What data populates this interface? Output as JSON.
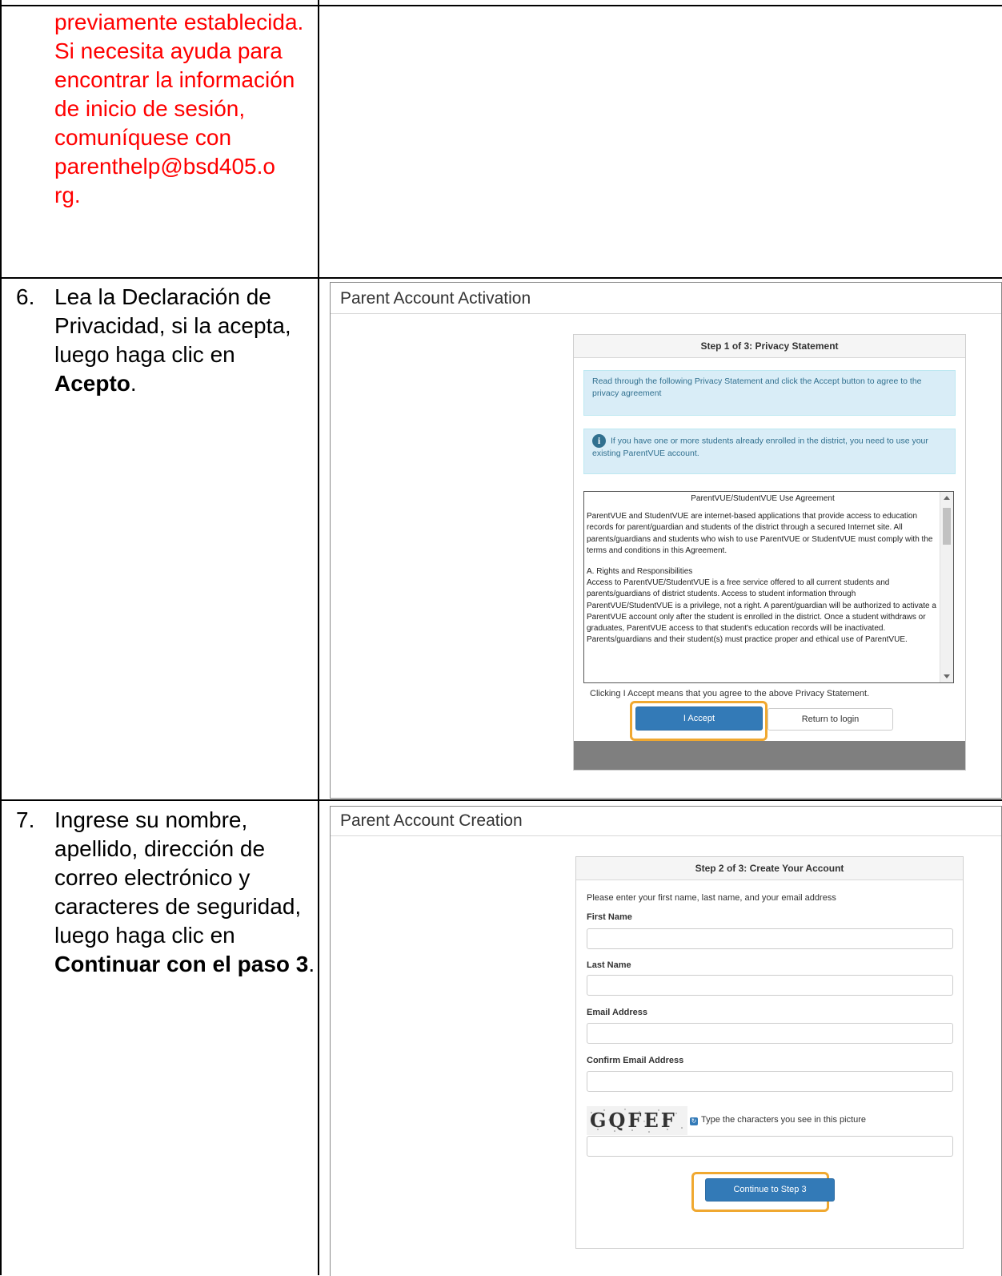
{
  "row1": {
    "red_text": "previamente establecida. Si necesita ayuda para encontrar la información de inicio de sesión, comuníquese con parenthelp@bsd405.o rg."
  },
  "row2": {
    "num": "6.",
    "text_before": "Lea la Declaración de Privacidad, si la acepta, luego haga clic en ",
    "bold": "Acepto",
    "text_after": "."
  },
  "row3": {
    "num": "7.",
    "text_before": "Ingrese su nombre, apellido, dirección de correo electrónico y caracteres de seguridad, luego haga clic en ",
    "bold": "Continuar con el paso 3",
    "text_after": "."
  },
  "activation": {
    "page_title": "Parent Account Activation",
    "panel_title": "Step 1 of 3: Privacy Statement",
    "alert1": "Read through the following Privacy Statement and click the Accept button to agree to the privacy agreement",
    "alert2": "If you have one or more students already enrolled in the district, you need to use your existing ParentVUE account.",
    "agreement_title": "ParentVUE/StudentVUE Use Agreement",
    "agreement_p1": "ParentVUE and StudentVUE are internet-based applications that provide access to education records for parent/guardian and students of the district through a secured Internet site. All parents/guardians and students who wish to use ParentVUE or StudentVUE must comply with the terms and conditions in this Agreement.",
    "agreement_h2": "A. Rights and Responsibilities",
    "agreement_p2": "Access to ParentVUE/StudentVUE is a free service offered to all current students and parents/guardians of district students. Access to student information through ParentVUE/StudentVUE is a privilege, not a right. A parent/guardian will be authorized to activate a ParentVUE account only after the student is enrolled in the district. Once a student withdraws or graduates, ParentVUE access to that student's education records will be inactivated. Parents/guardians and their student(s) must practice proper and ethical use of ParentVUE.",
    "consent": "Clicking I Accept means that you agree to the above Privacy Statement.",
    "accept_label": "I Accept",
    "return_label": "Return to login"
  },
  "creation": {
    "page_title": "Parent Account Creation",
    "panel_title": "Step 2 of 3: Create Your Account",
    "intro": "Please enter your first name, last name, and your email address",
    "first_name_label": "First Name",
    "last_name_label": "Last Name",
    "email_label": "Email Address",
    "confirm_email_label": "Confirm Email Address",
    "captcha_text": "GQFEF",
    "captcha_prompt": "Type the characters you see in this picture",
    "continue_label": "Continue to Step 3"
  },
  "colors": {
    "red_text": "#ff0000",
    "primary_button": "#337ab7",
    "highlight": "#f0a830",
    "alert_bg": "#d9edf7"
  }
}
